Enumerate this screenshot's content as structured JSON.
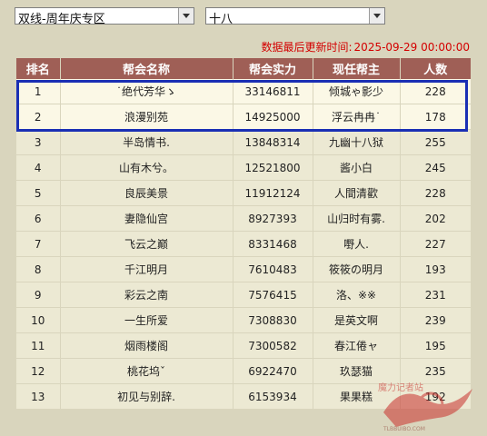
{
  "filters": {
    "server": "双线-周年庆专区",
    "group": "十八"
  },
  "update": {
    "label": "数据最后更新时间:",
    "time": "2025-09-29 00:00:00"
  },
  "table": {
    "headers": [
      "排名",
      "帮会名称",
      "帮会实力",
      "现任帮主",
      "人数"
    ],
    "rows": [
      [
        "1",
        "˙绝代芳华ゝ",
        "33146811",
        "倾城ゃ影少",
        "228"
      ],
      [
        "2",
        "浪漫别苑",
        "14925000",
        "浮云冉冉˙",
        "178"
      ],
      [
        "3",
        "半岛情书.",
        "13848314",
        "九幽十八狱",
        "255"
      ],
      [
        "4",
        "山有木兮。",
        "12521800",
        "酱小白",
        "245"
      ],
      [
        "5",
        "良辰美景",
        "11912124",
        "人間清歡",
        "228"
      ],
      [
        "6",
        "妻隐仙宫",
        "8927393",
        "山归时有雾.",
        "202"
      ],
      [
        "7",
        "飞云之巅",
        "8331468",
        "嘢人.",
        "227"
      ],
      [
        "8",
        "千江明月",
        "7610483",
        "筱筱の明月",
        "193"
      ],
      [
        "9",
        "彩云之南",
        "7576415",
        "洛、※※",
        "231"
      ],
      [
        "10",
        "一生所爱",
        "7308830",
        "是英文啊",
        "239"
      ],
      [
        "11",
        "烟雨楼阁",
        "7300582",
        "春江倦ャ",
        "195"
      ],
      [
        "12",
        "桃花坞ˇ",
        "6922470",
        "玖瑟猫",
        "235"
      ],
      [
        "13",
        "初见与别辞.",
        "6153934",
        "果果糕",
        "192"
      ]
    ]
  },
  "watermark": {
    "text": "魔力记者站",
    "sub": "TLBBUIBO.COM"
  },
  "colors": {
    "header_bg": "#9f5f56",
    "highlight_border": "#1a2fb4",
    "update_text": "#d40000",
    "page_bg": "#d9d5bd"
  }
}
